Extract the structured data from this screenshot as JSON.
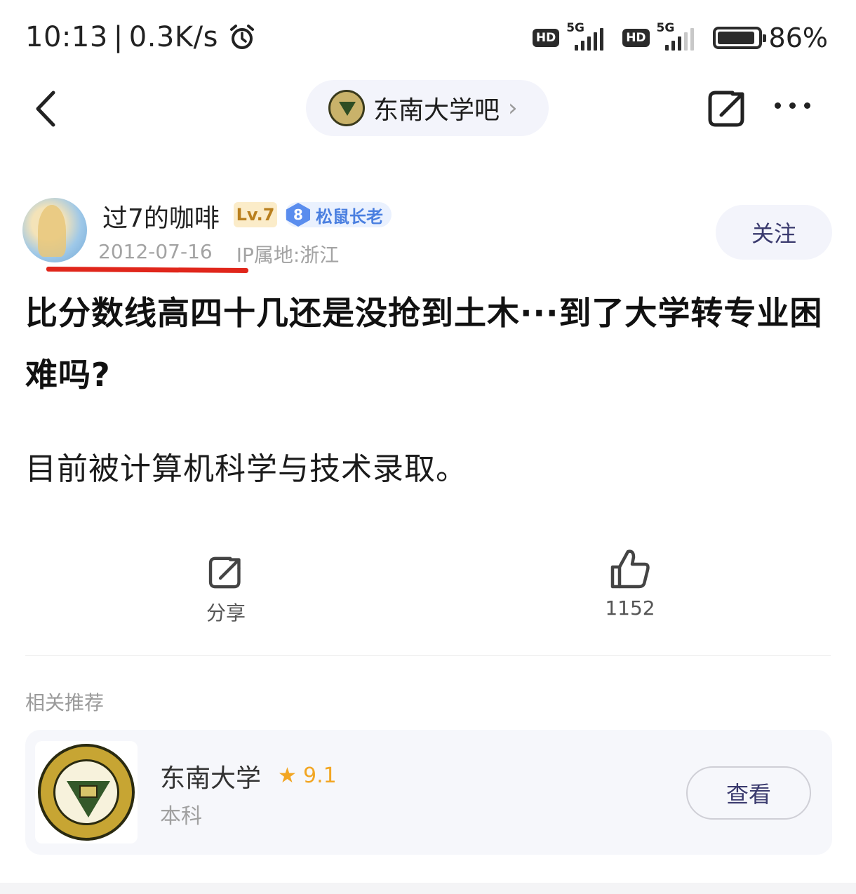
{
  "status_bar": {
    "time": "10:13",
    "separator": "|",
    "speed": "0.3K/s",
    "hd": "HD",
    "network": "5G",
    "battery": "86%"
  },
  "header": {
    "forum_name": "东南大学吧",
    "chevron": "›"
  },
  "author": {
    "name": "过7的咖啡",
    "level_badge": "Lv.7",
    "rank_number": "8",
    "rank_title": "松鼠长老",
    "date": "2012-07-16",
    "ip_location": "IP属地:浙江",
    "follow_label": "关注"
  },
  "post": {
    "title": "比分数线高四十几还是没抢到土木···到了大学转专业困难吗?",
    "body": "目前被计算机科学与技术录取。"
  },
  "actions": {
    "share_label": "分享",
    "like_count": "1152"
  },
  "recommend": {
    "section_label": "相关推荐",
    "name": "东南大学",
    "star": "★",
    "score": "9.1",
    "subtitle": "本科",
    "view_label": "查看"
  },
  "colors": {
    "accent_underline": "#e0261b",
    "pill_bg": "#f3f4fb",
    "score_orange": "#f2a623",
    "rank_blue": "#5a8dee"
  },
  "icons": [
    "alarm-icon",
    "back-icon",
    "forum-logo-icon",
    "share-icon",
    "more-icon",
    "like-icon",
    "star-icon",
    "university-seal-icon"
  ]
}
